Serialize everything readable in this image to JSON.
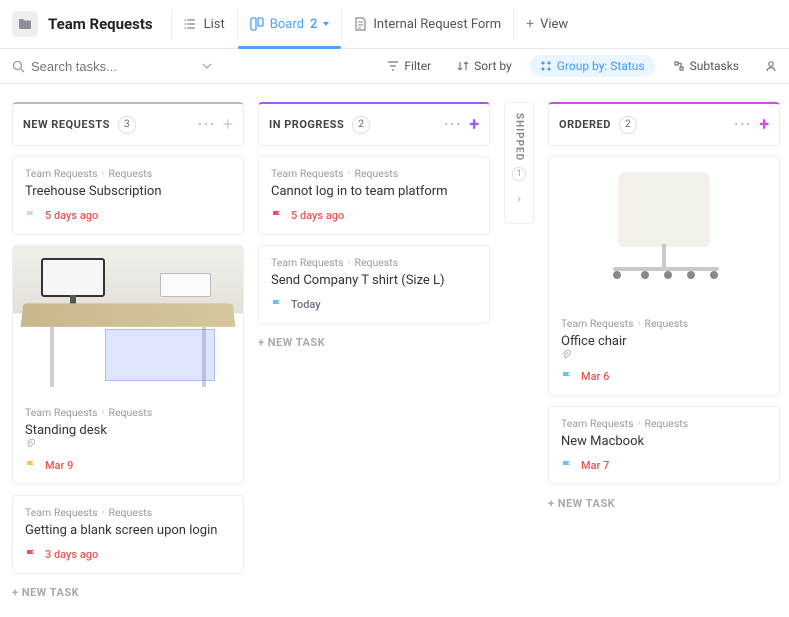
{
  "header": {
    "title": "Team Requests",
    "tabs": {
      "list": "List",
      "board": "Board",
      "board_count": "2",
      "form": "Internal Request Form",
      "add_view": "View"
    }
  },
  "toolbar": {
    "search_placeholder": "Search tasks...",
    "filter": "Filter",
    "sort": "Sort by",
    "group": "Group by: Status",
    "subtasks": "Subtasks"
  },
  "breadcrumb": {
    "parent": "Team Requests",
    "child": "Requests"
  },
  "new_task_label": "+ NEW TASK",
  "columns": {
    "new_requests": {
      "title": "NEW REQUESTS",
      "count": "3",
      "cards": [
        {
          "title": "Treehouse Subscription",
          "date": "5 days ago",
          "flag": "#d6d6d6"
        },
        {
          "title": "Standing desk",
          "date": "Mar 9",
          "flag": "#f5c542",
          "has_attachment": true,
          "image": "desk"
        },
        {
          "title": "Getting a blank screen upon login",
          "date": "3 days ago",
          "flag": "#e85454"
        }
      ]
    },
    "in_progress": {
      "title": "IN PROGRESS",
      "count": "2",
      "cards": [
        {
          "title": "Cannot log in to team platform",
          "date": "5 days ago",
          "flag": "#e85454"
        },
        {
          "title": "Send Company T shirt (Size L)",
          "date": "Today",
          "flag": "#5ec7f2",
          "date_muted": true
        }
      ]
    },
    "shipped": {
      "title": "SHIPPED",
      "count": "1"
    },
    "ordered": {
      "title": "ORDERED",
      "count": "2",
      "cards": [
        {
          "title": "Office chair",
          "date": "Mar 6",
          "flag": "#5ec7f2",
          "has_attachment": true,
          "image": "chair"
        },
        {
          "title": "New Macbook",
          "date": "Mar 7",
          "flag": "#5ec7f2"
        }
      ]
    }
  }
}
